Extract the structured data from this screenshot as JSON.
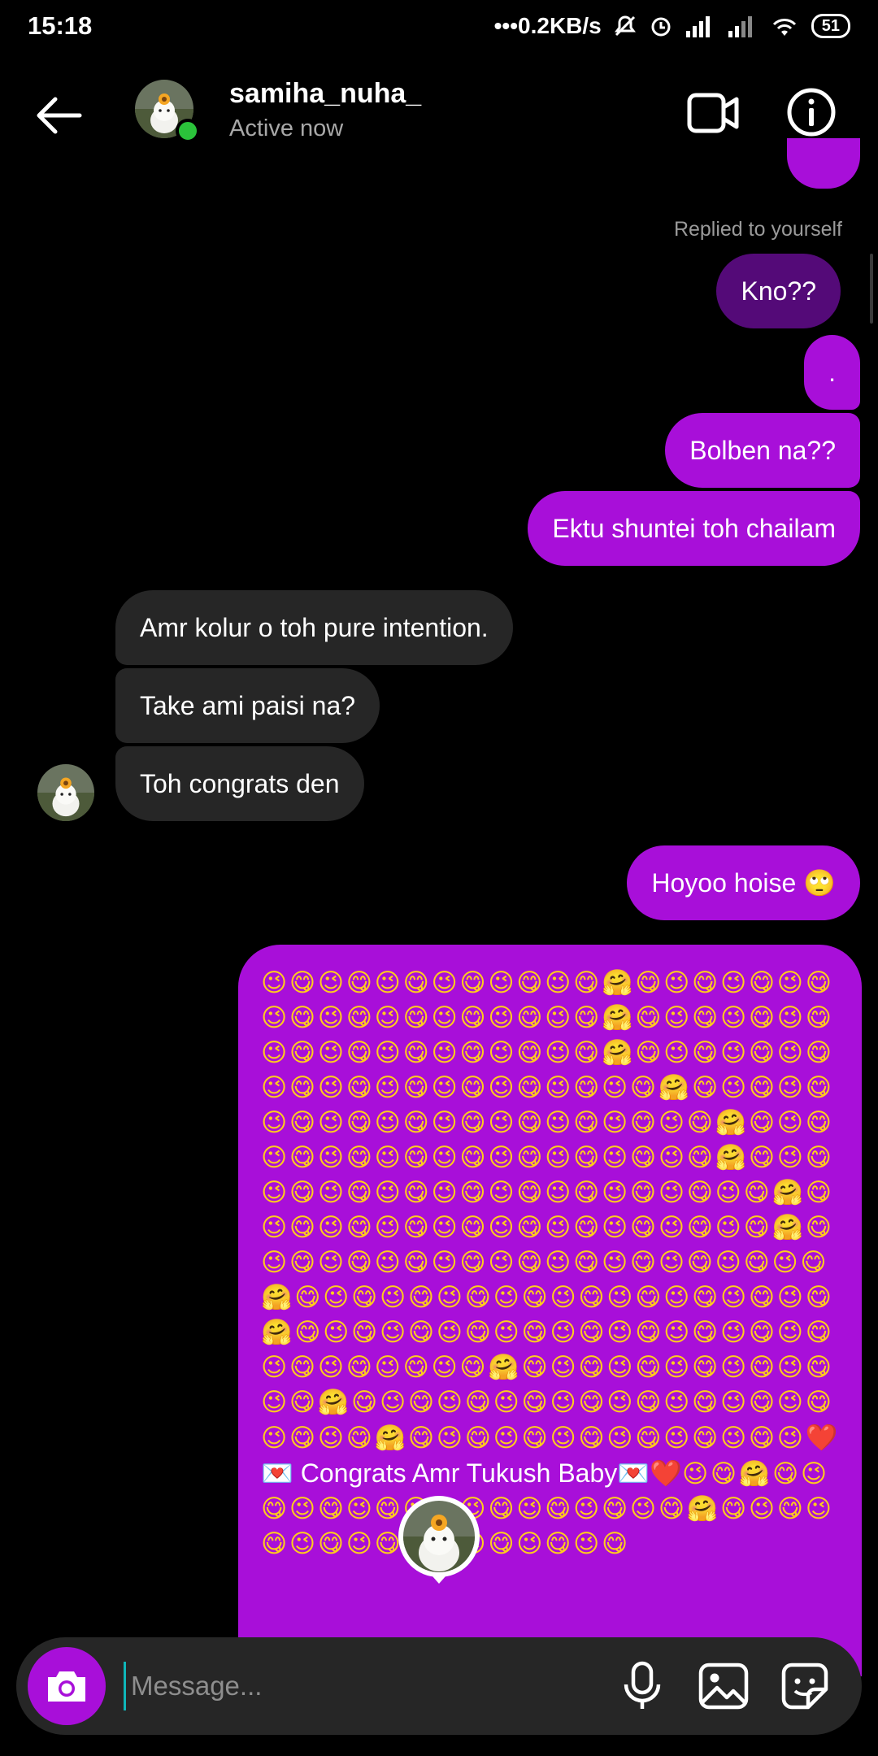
{
  "status_bar": {
    "time": "15:18",
    "speed": "•••0.2KB/s",
    "battery": "51"
  },
  "header": {
    "username": "samiha_nuha_",
    "status": "Active now",
    "icons": [
      "back-arrow-icon",
      "video-call-icon",
      "info-icon"
    ]
  },
  "messages": {
    "reply_note": "Replied to yourself",
    "outgoing": [
      "Kno??",
      ".",
      "Bolben na??",
      "Ektu shuntei toh chailam"
    ],
    "incoming": [
      "Amr kolur o toh pure intention.",
      "Take ami paisi na?",
      "Toh congrats den"
    ],
    "outgoing_after": "Hoyoo hoise 🙄",
    "emoji_block": {
      "before": "😉😋😉😋😉😋😉😋😉😋😉😋🤗😋😉😋😉😋😉😋😉😋😉😋😉😋😉😋😉😋😉😋🤗😋😉😋😉😋😉😋😉😋😉😋😉😋😉😋😉😋😉😋🤗😋😉😋😉😋😉😋😉😋😉😋😉😋😉😋😉😋😉😋😉😋🤗😋😉😋😉😋😉😋😉😋😉😋😉😋😉😋😉😋😉😋😉😋🤗😋😉😋😉😋😉😋😉😋😉😋😉😋😉😋😉😋😉😋🤗😋😉😋😉😋😉😋😉😋😉😋😉😋😉😋😉😋😉😋😉😋🤗😋😉😋😉😋😉😋😉😋😉😋😉😋😉😋😉😋😉😋🤗😋😉😋😉😋😉😋😉😋😉😋😉😋😉😋😉😋😉😋😉😋🤗😋😉😋😉😋😉😋😉😋😉😋😉😋😉😋😉😋😉😋🤗😋😉😋😉😋😉😋😉😋😉😋😉😋😉😋😉😋😉😋😉😋😉😋😉😋😉😋🤗😋😉😋😉😋😉😋😉😋😉😋😉😋🤗😋😉😋😉😋😉😋😉😋😉😋😉😋😉😋😉😋😉😋😉😋🤗😋😉😋😉😋😉😋😉😋😉😋😉😋😉",
      "congrats": "❤️💌 Congrats Amr Tukush Baby💌❤️",
      "after": "😉😋🤗😋😉😋😉😋😉😋😉😋😉😋😉😋😉😋😉😋🤗😋😉😋😉😋😉😋😉😋😉😋😉😋😉😋😉😋"
    }
  },
  "composer": {
    "placeholder": "Message..."
  },
  "colors": {
    "outgoing_bubble": "#a80fd9",
    "incoming_bubble": "#262626",
    "online_dot": "#2bc33b"
  }
}
